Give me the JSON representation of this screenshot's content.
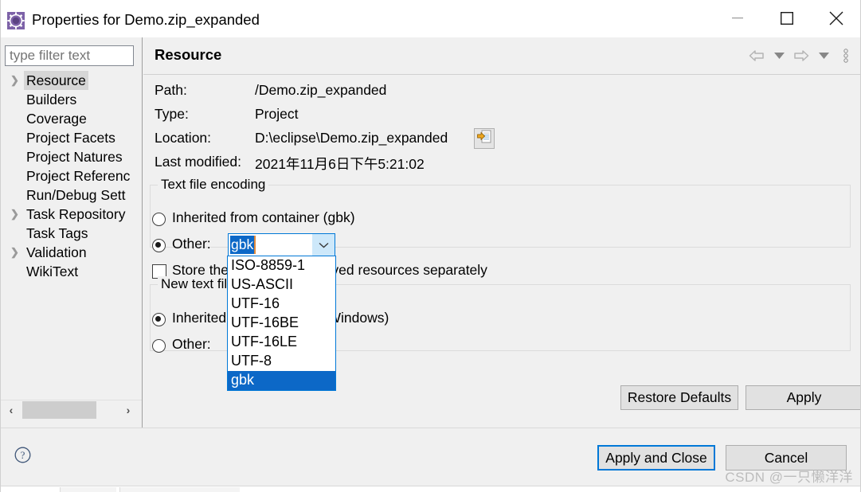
{
  "window": {
    "title": "Properties for Demo.zip_expanded",
    "icon": "eclipse-properties-gear-icon",
    "minimize_label": "—",
    "maximize_label": "□",
    "close_label": "✕"
  },
  "sidebar": {
    "filter": {
      "placeholder": "type filter text",
      "value": ""
    },
    "items": [
      {
        "label": "Resource",
        "expandable": true,
        "selected": true
      },
      {
        "label": "Builders",
        "expandable": false,
        "selected": false
      },
      {
        "label": "Coverage",
        "expandable": false,
        "selected": false
      },
      {
        "label": "Project Facets",
        "expandable": false,
        "selected": false
      },
      {
        "label": "Project Natures",
        "expandable": false,
        "selected": false
      },
      {
        "label": "Project Referenc",
        "expandable": false,
        "selected": false
      },
      {
        "label": "Run/Debug Sett",
        "expandable": false,
        "selected": false
      },
      {
        "label": "Task Repository",
        "expandable": true,
        "selected": false
      },
      {
        "label": "Task Tags",
        "expandable": false,
        "selected": false
      },
      {
        "label": "Validation",
        "expandable": true,
        "selected": false
      },
      {
        "label": "WikiText",
        "expandable": false,
        "selected": false
      }
    ],
    "scrollbar": {
      "left_arrow": "‹",
      "right_arrow": "›"
    }
  },
  "page": {
    "title": "Resource",
    "nav": {
      "back_icon": "back-arrow-icon",
      "back_menu_icon": "chevron-down-icon",
      "forward_icon": "forward-arrow-icon",
      "forward_menu_icon": "chevron-down-icon",
      "more_icon": "vertical-dots-icon"
    },
    "info": [
      {
        "label": "Path:",
        "value": "/Demo.zip_expanded"
      },
      {
        "label": "Type:",
        "value": "Project"
      },
      {
        "label": "Location:",
        "value": "D:\\eclipse\\Demo.zip_expanded"
      },
      {
        "label": "Last modified:",
        "value": "2021年11月6日下午5:21:02"
      }
    ],
    "location_button_icon": "open-in-explorer-icon",
    "encoding_group": {
      "title": "Text file encoding",
      "inherited_label": "Inherited from container (gbk)",
      "inherited_selected": false,
      "other_label": "Other:",
      "other_selected": true,
      "combo_value": "gbk",
      "combo_arrow_icon": "chevron-down-icon",
      "store_checkbox_label": "Store the encoding of derived resources separately",
      "store_checkbox_checked": false,
      "options": [
        "ISO-8859-1",
        "US-ASCII",
        "UTF-16",
        "UTF-16BE",
        "UTF-16LE",
        "UTF-8",
        "gbk"
      ],
      "selected_option": "gbk"
    },
    "delimiter_group": {
      "title": "New text file line delimiter",
      "inherited_label": "Inherited from container (Windows)",
      "inherited_selected": true,
      "other_label": "Other:",
      "other_selected": false
    },
    "restore_defaults_label": "Restore Defaults",
    "apply_label": "Apply"
  },
  "footer": {
    "help_icon": "help-question-icon",
    "apply_and_close_label": "Apply and Close",
    "cancel_label": "Cancel",
    "watermark": "CSDN @一只懒洋洋"
  },
  "colors": {
    "accent": "#0078d7",
    "selection": "#0c68c7",
    "dialog_bg": "#f0f0f0",
    "button_bg": "#e1e1e1"
  }
}
